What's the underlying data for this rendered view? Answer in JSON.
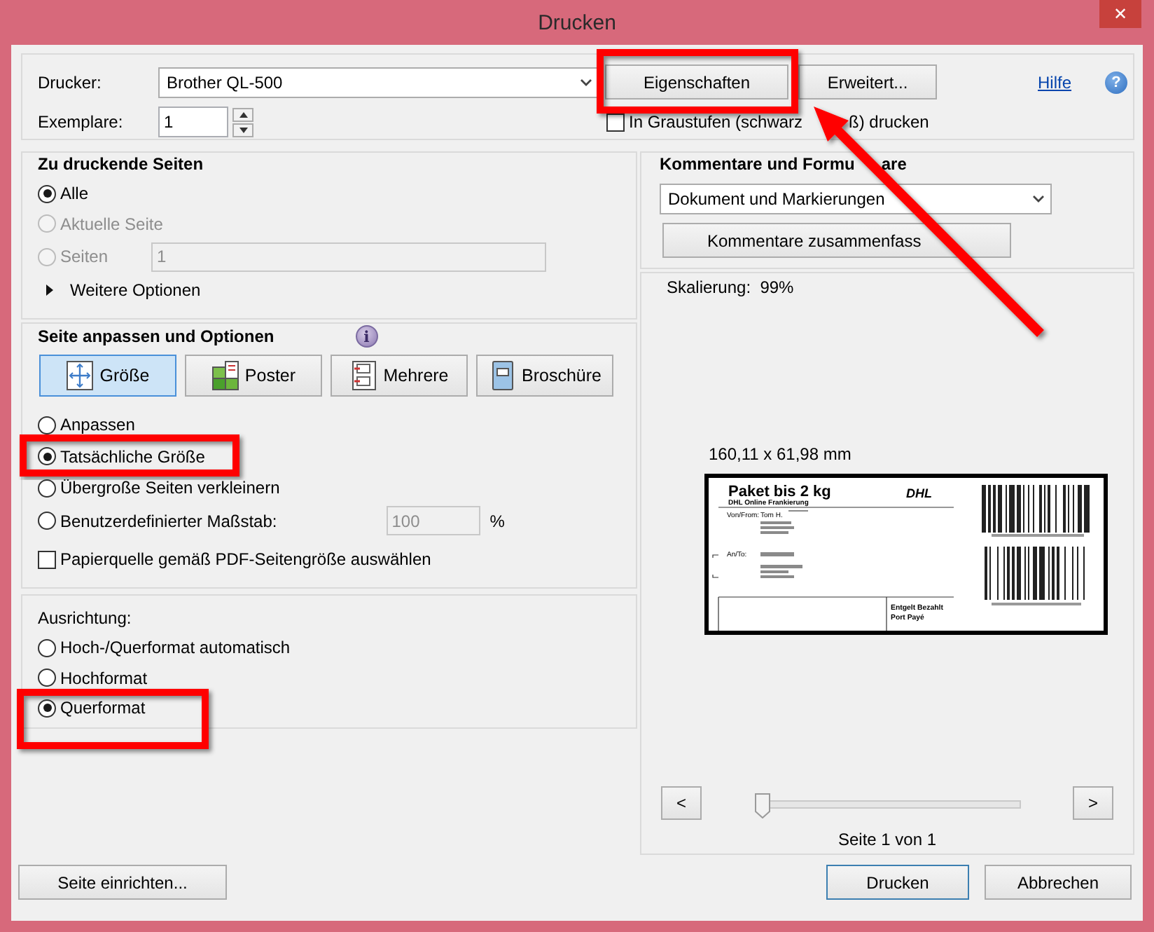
{
  "window": {
    "title": "Drucken",
    "close": "✕"
  },
  "printer": {
    "label": "Drucker:",
    "value": "Brother QL-500",
    "properties_button": "Eigenschaften",
    "advanced_button": "Erweitert...",
    "help_link": "Hilfe",
    "help_glyph": "?",
    "copies_label": "Exemplare:",
    "copies": "1",
    "grayscale": {
      "label": "In Graustufen (schwarz",
      "label_end": "ß) drucken",
      "checked": false
    }
  },
  "pages": {
    "title": "Zu druckende Seiten",
    "options": [
      {
        "label": "Alle",
        "selected": true,
        "disabled": false
      },
      {
        "label": "Aktuelle Seite",
        "selected": false,
        "disabled": true
      },
      {
        "label": "Seiten",
        "selected": false,
        "disabled": true
      }
    ],
    "range": {
      "value": "1",
      "disabled": true
    },
    "more_options": {
      "label": "Weitere Optionen",
      "expanded": false
    }
  },
  "fit": {
    "title": "Seite anpassen und Optionen",
    "info_glyph": "i",
    "modes": [
      {
        "kind": "size",
        "label": "Größe",
        "selected": true
      },
      {
        "kind": "poster",
        "label": "Poster",
        "selected": false
      },
      {
        "kind": "multiple",
        "label": "Mehrere",
        "selected": false
      },
      {
        "kind": "booklet",
        "label": "Broschüre",
        "selected": false
      }
    ],
    "options": [
      {
        "label": "Anpassen",
        "selected": false
      },
      {
        "label": "Tatsächliche Größe",
        "selected": true
      },
      {
        "label": "Übergroße Seiten verkleinern",
        "selected": false
      },
      {
        "label": "Benutzerdefinierter Maßstab:",
        "selected": false
      }
    ],
    "scale": {
      "value": "100",
      "disabled": true
    },
    "scale_unit": "%",
    "paper_source": {
      "label": "Papierquelle gemäß PDF-Seitengröße auswählen",
      "checked": false
    }
  },
  "orientation": {
    "title": "Ausrichtung:",
    "options": [
      {
        "label": "Hoch-/Querformat automatisch",
        "selected": false
      },
      {
        "label": "Hochformat",
        "selected": false
      },
      {
        "label": "Querformat",
        "selected": true
      }
    ]
  },
  "comments": {
    "title": "Kommentare und Formu",
    "title_end": "are",
    "value": "Dokument und Markierungen",
    "summary_button": "Kommentare zusammenfass"
  },
  "preview": {
    "scaling": "Skalierung:  99%",
    "size": "160,11 x 61,98 mm",
    "label": {
      "heading": "Paket bis 2 kg",
      "service": "DHL Online Frankierung",
      "logo": "DHL",
      "from_label": "Von/From:",
      "from_name": "Tom H.",
      "to_label": "An/To:",
      "postage": "Entgelt Bezahlt",
      "postage_fr": "Port Payé"
    },
    "prev": "<",
    "next": ">",
    "slider": {
      "level": 0
    },
    "page": "Seite 1 von 1"
  },
  "footer": {
    "setup_button": "Seite einrichten...",
    "print_button": "Drucken",
    "cancel_button": "Abbrechen"
  },
  "annotations": [
    {
      "kind": "box"
    },
    {
      "kind": "box"
    },
    {
      "kind": "box"
    },
    {
      "kind": "arrow"
    }
  ]
}
